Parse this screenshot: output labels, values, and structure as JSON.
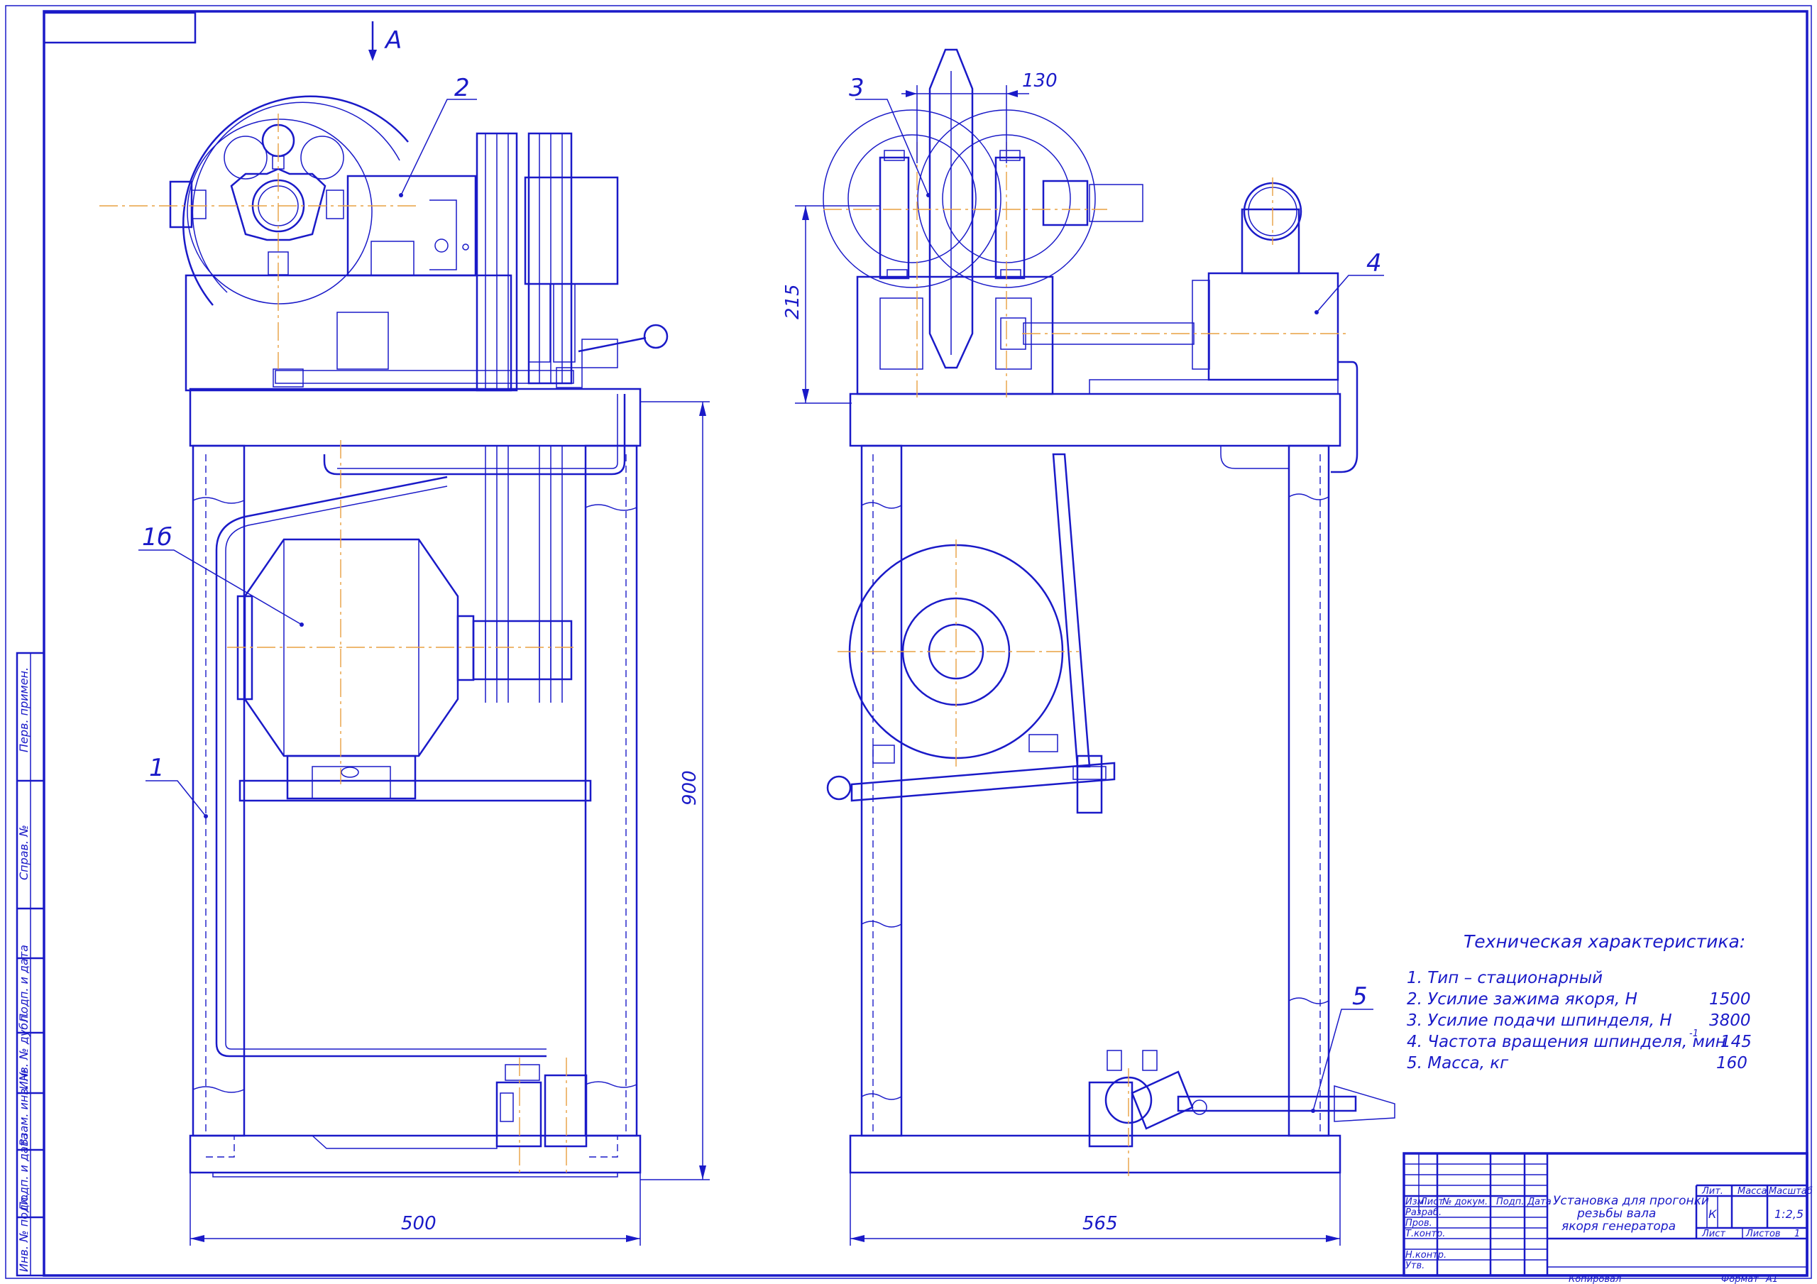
{
  "view_label": "А",
  "callouts": [
    "2",
    "3",
    "4",
    "1б",
    "1",
    "5"
  ],
  "dimensions": {
    "width_front": "500",
    "width_side": "565",
    "height": "900",
    "height_top": "215",
    "spacing": "130"
  },
  "tech": {
    "title": "Техническая характеристика:",
    "items": [
      {
        "label": "1. Тип – стационарный",
        "value": ""
      },
      {
        "label": "2. Усилие зажима якоря, Н",
        "value": "1500"
      },
      {
        "label": "3. Усилие подачи шпинделя, Н",
        "value": "3800"
      },
      {
        "label": "4. Частота вращения шпинделя, мин",
        "value": "145"
      },
      {
        "label": "5. Масса, кг",
        "value": "160"
      }
    ],
    "superscript": "-1"
  },
  "side_stamp": [
    "Перв. примен.",
    "Справ. №",
    "Подп. и дата",
    "Инв. № дубл.",
    "Взам. инв. №",
    "Подп. и дата",
    "Инв. № подл."
  ],
  "title_block": {
    "title_lines": [
      "Установка для прогонки",
      "резьбы вала",
      "якоря генератора"
    ],
    "header_cols": [
      "Изм",
      "Лист",
      "№ докум.",
      "Подп.",
      "Дата"
    ],
    "rows": [
      "Разраб.",
      "Пров.",
      "Т.контр.",
      "",
      "Н.контр.",
      "Утв."
    ],
    "lit_label": "Лит.",
    "mass_label": "Масса",
    "scale_label": "Масштаб",
    "lit_value": "К",
    "scale_value": "1:2,5",
    "sheet_label": "Лист",
    "sheets_label": "Листов",
    "sheets_value": "1",
    "copied_label": "Копировал",
    "format_label": "Формат",
    "format_value": "А1"
  }
}
